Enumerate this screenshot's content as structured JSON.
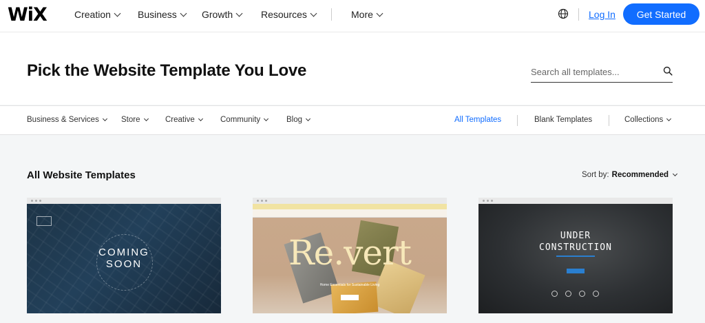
{
  "topnav": {
    "logo": "WiX",
    "items": [
      {
        "label": "Creation"
      },
      {
        "label": "Business"
      },
      {
        "label": "Growth"
      },
      {
        "label": "Resources"
      }
    ],
    "more": "More",
    "login": "Log In",
    "cta": "Get Started"
  },
  "header": {
    "title": "Pick the Website Template You Love",
    "search_placeholder": "Search all templates..."
  },
  "categories": {
    "left": [
      {
        "label": "Business & Services"
      },
      {
        "label": "Store"
      },
      {
        "label": "Creative"
      },
      {
        "label": "Community"
      },
      {
        "label": "Blog"
      }
    ],
    "right": [
      {
        "label": "All Templates",
        "active": true
      },
      {
        "label": "Blank Templates"
      },
      {
        "label": "Collections"
      }
    ]
  },
  "content": {
    "section_title": "All Website Templates",
    "sort_label": "Sort by:",
    "sort_value": "Recommended"
  },
  "templates": [
    {
      "heading": "COMING SOON",
      "line1": "COMING",
      "line2": "SOON"
    },
    {
      "heading": "Re.vert",
      "subtitle": "Home Essentials for Sustainable Living"
    },
    {
      "heading": "UNDER CONSTRUCTION",
      "line1": "UNDER",
      "line2": "CONSTRUCTION"
    }
  ],
  "colors": {
    "accent": "#116dff",
    "page_bg": "#f4f6f7"
  }
}
